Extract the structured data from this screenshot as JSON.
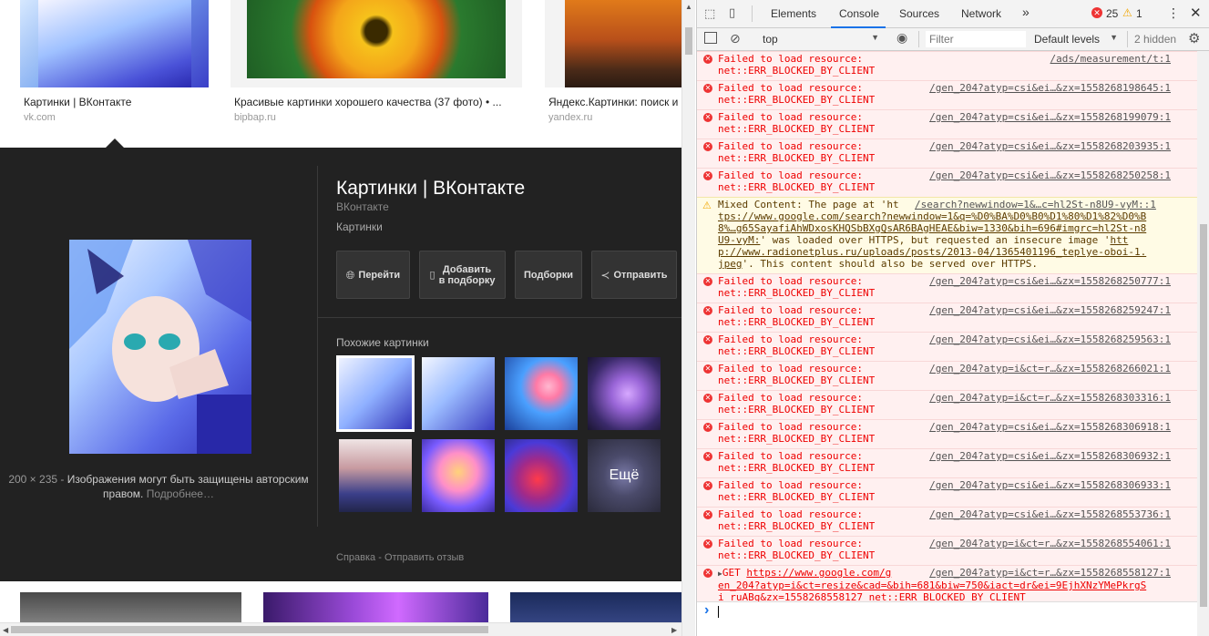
{
  "results": [
    {
      "title": "Картинки | ВКонтакте",
      "site": "vk.com"
    },
    {
      "title": "Красивые картинки хорошего качества (37 фото) • ...",
      "site": "bipbap.ru"
    },
    {
      "title": "Яндекс.Картинки: поиск и",
      "site": "yandex.ru"
    }
  ],
  "detail": {
    "title": "Картинки | ВКонтакте",
    "site": "ВКонтакте",
    "subtitle": "Картинки",
    "actions": {
      "go": "Перейти",
      "add": "Добавить в подборку",
      "collections": "Подборки",
      "share": "Отправить"
    },
    "similar_label": "Похожие картинки",
    "more_label": "Ещё",
    "dimensions": "200 × 235",
    "copyright": "Изображения могут быть защищены авторским правом.",
    "more_link": "Подробнее…",
    "footer_help": "Справка",
    "footer_feedback": "Отправить отзыв"
  },
  "devtools": {
    "tabs": [
      "Elements",
      "Console",
      "Sources",
      "Network"
    ],
    "active_tab": "Console",
    "more_tabs": "»",
    "error_count": "25",
    "warning_count": "1",
    "context": "top",
    "filter_placeholder": "Filter",
    "levels": "Default levels",
    "hidden": "2 hidden",
    "messages": [
      {
        "type": "error",
        "text": "Failed to load resource:\nnet::ERR_BLOCKED_BY_CLIENT",
        "src": "/ads/measurement/t:1"
      },
      {
        "type": "error",
        "text": "Failed to load resource:\nnet::ERR_BLOCKED_BY_CLIENT",
        "src": "/gen_204?atyp=csi&ei…&zx=1558268198645:1"
      },
      {
        "type": "error",
        "text": "Failed to load resource:\nnet::ERR_BLOCKED_BY_CLIENT",
        "src": "/gen_204?atyp=csi&ei…&zx=1558268199079:1"
      },
      {
        "type": "error",
        "text": "Failed to load resource:\nnet::ERR_BLOCKED_BY_CLIENT",
        "src": "/gen_204?atyp=csi&ei…&zx=1558268203935:1"
      },
      {
        "type": "error",
        "text": "Failed to load resource:\nnet::ERR_BLOCKED_BY_CLIENT",
        "src": "/gen_204?atyp=csi&ei…&zx=1558268250258:1"
      },
      {
        "type": "warning",
        "line1": "Mixed Content: The page at 'ht",
        "line1src": "/search?newwindow=1&…c=hl2St-n8U9-vyM::1",
        "line2": "tps://www.google.com/search?newwindow=1&q=%D0%BA%D0%B0%D1%80%D1%82%D0%B",
        "line3": "8%…g65SayafiAhWDxosKHQSbBXgQsAR6BAgHEAE&biw=1330&bih=696#imgrc=hl2St-n8",
        "line4a": "U9-vyM:",
        "line4b": "' was loaded over HTTPS, but requested an insecure image '",
        "line4c": "htt",
        "line5a": "p://www.radionetplus.ru/uploads/posts/2013-04/1365401196_teplye-oboi-1.",
        "line6a": "jpeg",
        "line6b": "'. This content should also be served over HTTPS."
      },
      {
        "type": "error",
        "text": "Failed to load resource:\nnet::ERR_BLOCKED_BY_CLIENT",
        "src": "/gen_204?atyp=csi&ei…&zx=1558268250777:1"
      },
      {
        "type": "error",
        "text": "Failed to load resource:\nnet::ERR_BLOCKED_BY_CLIENT",
        "src": "/gen_204?atyp=csi&ei…&zx=1558268259247:1"
      },
      {
        "type": "error",
        "text": "Failed to load resource:\nnet::ERR_BLOCKED_BY_CLIENT",
        "src": "/gen_204?atyp=csi&ei…&zx=1558268259563:1"
      },
      {
        "type": "error",
        "text": "Failed to load resource:\nnet::ERR_BLOCKED_BY_CLIENT",
        "src": "/gen_204?atyp=i&ct=r…&zx=1558268266021:1"
      },
      {
        "type": "error",
        "text": "Failed to load resource:\nnet::ERR_BLOCKED_BY_CLIENT",
        "src": "/gen_204?atyp=i&ct=r…&zx=1558268303316:1"
      },
      {
        "type": "error",
        "text": "Failed to load resource:\nnet::ERR_BLOCKED_BY_CLIENT",
        "src": "/gen_204?atyp=csi&ei…&zx=1558268306918:1"
      },
      {
        "type": "error",
        "text": "Failed to load resource:\nnet::ERR_BLOCKED_BY_CLIENT",
        "src": "/gen_204?atyp=csi&ei…&zx=1558268306932:1"
      },
      {
        "type": "error",
        "text": "Failed to load resource:\nnet::ERR_BLOCKED_BY_CLIENT",
        "src": "/gen_204?atyp=csi&ei…&zx=1558268306933:1"
      },
      {
        "type": "error",
        "text": "Failed to load resource:\nnet::ERR_BLOCKED_BY_CLIENT",
        "src": "/gen_204?atyp=csi&ei…&zx=1558268553736:1"
      },
      {
        "type": "error",
        "text": "Failed to load resource:\nnet::ERR_BLOCKED_BY_CLIENT",
        "src": "/gen_204?atyp=i&ct=r…&zx=1558268554061:1"
      }
    ],
    "get_msg": {
      "method": "GET",
      "url1": "https://www.google.com/g",
      "src": "/gen_204?atyp=i&ct=r…&zx=1558268558127:1",
      "url2": "en_204?atyp=i&ct=resize&cad=&bih=681&biw=750&iact=dr&ei=9EjhXNzYMePkrgS",
      "url3": "i_ruABg&zx=1558268558127",
      "err": "net::ERR_BLOCKED_BY_CLIENT"
    },
    "prompt_symbol": "›"
  }
}
